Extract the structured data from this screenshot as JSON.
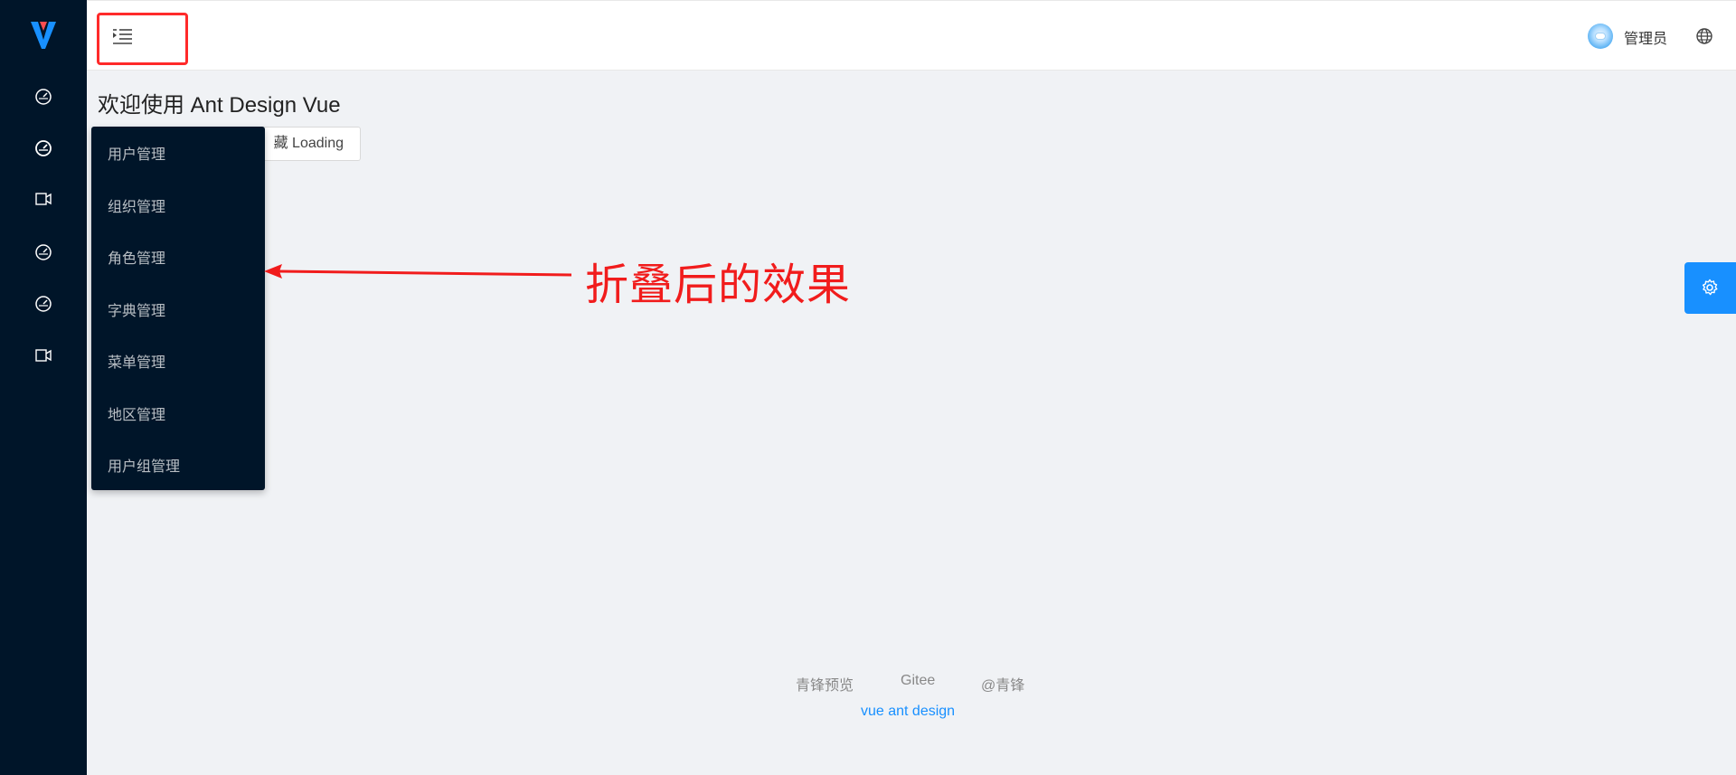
{
  "app": {
    "logo_name": "vue-logo"
  },
  "sidebar": {
    "icons": [
      "dashboard-icon",
      "dashboard-icon",
      "video-camera-icon",
      "dashboard-icon",
      "dashboard-icon",
      "video-camera-icon"
    ]
  },
  "header": {
    "username": "管理员"
  },
  "main": {
    "welcome_title": "欢迎使用 Ant Design Vue",
    "loading_button_label": "藏 Loading"
  },
  "popup_menu": {
    "items": [
      {
        "label": "用户管理"
      },
      {
        "label": "组织管理"
      },
      {
        "label": "角色管理"
      },
      {
        "label": "字典管理"
      },
      {
        "label": "菜单管理"
      },
      {
        "label": "地区管理"
      },
      {
        "label": "用户组管理"
      }
    ]
  },
  "annotation": {
    "text": "折叠后的效果",
    "color": "#f11c1c"
  },
  "footer": {
    "links": [
      "青锋预览",
      "Gitee",
      "@青锋"
    ],
    "sub_link": "vue ant design"
  },
  "colors": {
    "sider_bg": "#001529",
    "accent": "#1890ff",
    "highlight_border": "#ff2a2a"
  }
}
